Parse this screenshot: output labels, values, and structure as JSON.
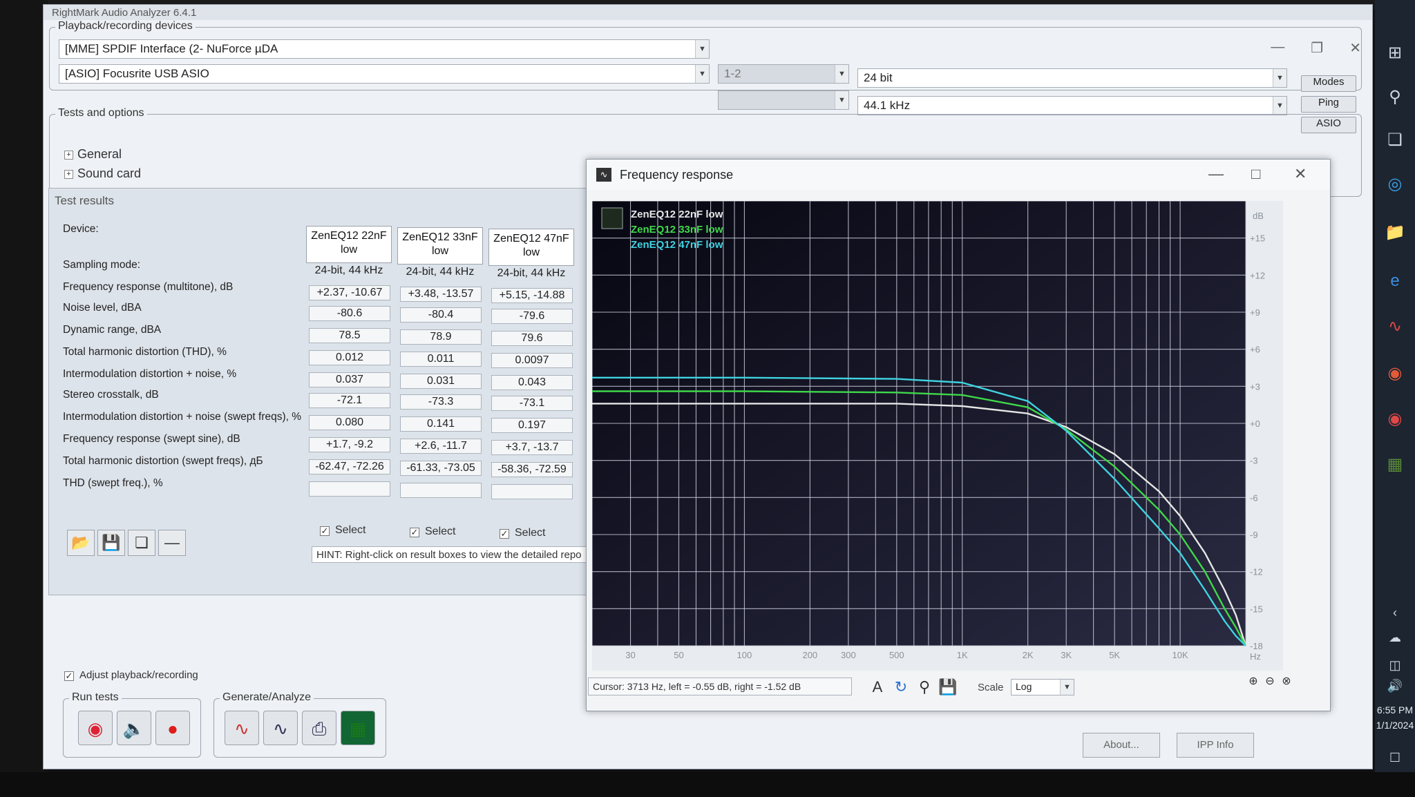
{
  "app": {
    "title": "RightMark Audio Analyzer 6.4.1",
    "devices_group": "Playback/recording devices",
    "playback_device": "[MME] SPDIF Interface (2- NuForce µDA",
    "recording_device": "[ASIO] Focusrite USB ASIO",
    "channels": "1-2",
    "channels2": "",
    "bit_depth": "24 bit",
    "sample_rate": "44.1 kHz",
    "buttons": {
      "modes": "Modes",
      "ping": "Ping",
      "asio": "ASIO"
    },
    "tests_group": "Tests and options",
    "tree": [
      "General",
      "Sound card"
    ]
  },
  "results": {
    "title": "Test results",
    "device_label": "Device:",
    "columns": [
      {
        "name": "ZenEQ12 22nF low",
        "line1": "ZenEQ12 22nF",
        "line2": "low"
      },
      {
        "name": "ZenEQ12 33nF low",
        "line1": "ZenEQ12 33nF",
        "line2": "low"
      },
      {
        "name": "ZenEQ12 47nF low",
        "line1": "ZenEQ12 47nF",
        "line2": "low"
      }
    ],
    "rows": [
      {
        "label": "Sampling mode:",
        "values": [
          "24-bit, 44 kHz",
          "24-bit, 44 kHz",
          "24-bit, 44 kHz"
        ],
        "plain": true
      },
      {
        "label": "Frequency response (multitone), dB",
        "values": [
          "+2.37, -10.67",
          "+3.48, -13.57",
          "+5.15, -14.88"
        ]
      },
      {
        "label": "Noise level, dBA",
        "values": [
          "-80.6",
          "-80.4",
          "-79.6"
        ]
      },
      {
        "label": "Dynamic range, dBA",
        "values": [
          "78.5",
          "78.9",
          "79.6"
        ]
      },
      {
        "label": "Total harmonic distortion (THD), %",
        "values": [
          "0.012",
          "0.011",
          "0.0097"
        ]
      },
      {
        "label": "Intermodulation distortion + noise, %",
        "values": [
          "0.037",
          "0.031",
          "0.043"
        ]
      },
      {
        "label": "Stereo crosstalk, dB",
        "values": [
          "-72.1",
          "-73.3",
          "-73.1"
        ]
      },
      {
        "label": "Intermodulation distortion + noise (swept freqs), %",
        "values": [
          "0.080",
          "0.141",
          "0.197"
        ]
      },
      {
        "label": "Frequency response (swept sine), dB",
        "values": [
          "+1.7, -9.2",
          "+2.6, -11.7",
          "+3.7, -13.7"
        ]
      },
      {
        "label": "Total harmonic distortion (swept freqs), дБ",
        "values": [
          "-62.47, -72.26",
          "-61.33, -73.05",
          "-58.36, -72.59"
        ]
      },
      {
        "label": "THD (swept freq.), %",
        "values": [
          "",
          "",
          ""
        ]
      }
    ],
    "select_label": "Select",
    "hint": "HINT: Right-click on result boxes to view the detailed repo"
  },
  "bottom": {
    "adjust_label": "Adjust playback/recording",
    "run_tests": "Run tests",
    "generate_analyze": "Generate/Analyze",
    "about": "About...",
    "ipp_info": "IPP Info"
  },
  "fr_window": {
    "title": "Frequency response",
    "cursor_text": "Cursor:  3713 Hz,  left = -0.55 dB,  right = -1.52 dB",
    "scale_label": "Scale",
    "scale_value": "Log"
  },
  "chart_data": {
    "type": "line",
    "title": "",
    "xlabel": "Hz",
    "ylabel": "dB",
    "x_scale": "log",
    "xlim": [
      20,
      20000
    ],
    "ylim": [
      -18,
      18
    ],
    "x_ticks": [
      "30",
      "50",
      "100",
      "200",
      "300",
      "500",
      "1K",
      "2K",
      "3K",
      "5K",
      "10K"
    ],
    "y_ticks": [
      "+15",
      "+12",
      "+9",
      "+6",
      "+3",
      "+0",
      "-3",
      "-6",
      "-9",
      "-12",
      "-15",
      "-18"
    ],
    "grid": true,
    "legend": "top-left",
    "series": [
      {
        "name": "ZenEQ12 22nF low",
        "color": "#e6e6e6",
        "x": [
          20,
          100,
          500,
          1000,
          2000,
          3000,
          5000,
          8000,
          10000,
          13000,
          16000,
          18000,
          20000
        ],
        "y": [
          1.6,
          1.6,
          1.6,
          1.4,
          0.8,
          -0.3,
          -2.5,
          -5.5,
          -7.5,
          -10.5,
          -13.5,
          -15.5,
          -18
        ]
      },
      {
        "name": "ZenEQ12 33nF low",
        "color": "#3fd94a",
        "x": [
          20,
          100,
          500,
          1000,
          2000,
          3000,
          5000,
          8000,
          10000,
          13000,
          16000,
          18000,
          20000
        ],
        "y": [
          2.6,
          2.6,
          2.5,
          2.3,
          1.3,
          -0.5,
          -3.5,
          -7.0,
          -9.0,
          -12.0,
          -15.0,
          -16.5,
          -18
        ]
      },
      {
        "name": "ZenEQ12 47nF low",
        "color": "#3fd3e0",
        "x": [
          20,
          100,
          500,
          1000,
          2000,
          3000,
          5000,
          8000,
          10000,
          13000,
          16000,
          18000,
          20000
        ],
        "y": [
          3.7,
          3.7,
          3.6,
          3.3,
          1.8,
          -0.6,
          -4.5,
          -8.5,
          -10.5,
          -13.5,
          -16.0,
          -17.2,
          -18
        ]
      }
    ]
  },
  "taskbar": {
    "time": "6:55 PM",
    "date": "1/1/2024"
  }
}
